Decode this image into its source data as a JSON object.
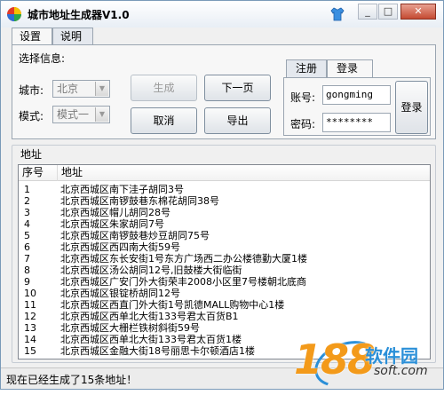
{
  "window": {
    "title": "城市地址生成器V1.0"
  },
  "titlebar_buttons": {
    "minimize": "_",
    "maximize": "□",
    "close": "✕"
  },
  "top_tabs": [
    "设置",
    "说明"
  ],
  "settings": {
    "heading": "选择信息:",
    "city_label": "城市:",
    "city_value": "北京",
    "mode_label": "模式:",
    "mode_value": "模式一",
    "generate_button": "生成",
    "next_page_button": "下一页",
    "cancel_button": "取消",
    "export_button": "导出"
  },
  "account": {
    "tabs": [
      "注册",
      "登录"
    ],
    "username_label": "账号:",
    "username_value": "gongming",
    "password_label": "密码:",
    "password_value": "********",
    "login_button": "登录"
  },
  "address_group": {
    "title": "地址",
    "columns": [
      "序号",
      "地址"
    ],
    "rows": [
      {
        "no": "1",
        "addr": "北京西城区南下洼子胡同3号"
      },
      {
        "no": "2",
        "addr": "北京西城区南锣鼓巷东棉花胡同38号"
      },
      {
        "no": "3",
        "addr": "北京西城区帽儿胡同28号"
      },
      {
        "no": "4",
        "addr": "北京西城区朱家胡同7号"
      },
      {
        "no": "5",
        "addr": "北京西城区南锣鼓巷炒豆胡同75号"
      },
      {
        "no": "6",
        "addr": "北京西城区西四南大街59号"
      },
      {
        "no": "7",
        "addr": "北京西城区东长安街1号东方广场西二办公楼德勤大厦1楼"
      },
      {
        "no": "8",
        "addr": "北京西城区汤公胡同12号,旧鼓楼大街临街"
      },
      {
        "no": "9",
        "addr": "北京西城区广安门外大街荣丰2008小区里7号楼朝北底商"
      },
      {
        "no": "10",
        "addr": "北京西城区银锭桥胡同12号"
      },
      {
        "no": "11",
        "addr": "北京西城区西直门外大街1号凯德MALL购物中心1楼"
      },
      {
        "no": "12",
        "addr": "北京西城区西单北大街133号君太百货B1"
      },
      {
        "no": "13",
        "addr": "北京西城区大栅栏铁树斜街59号"
      },
      {
        "no": "14",
        "addr": "北京西城区西单北大街133号君太百货1楼"
      },
      {
        "no": "15",
        "addr": "北京西城区金融大街18号丽思卡尔顿酒店1楼"
      }
    ]
  },
  "status": {
    "text": "现在已经生成了15条地址！"
  },
  "watermark": {
    "number": "188",
    "name": "软件园",
    "domain": "soft.com"
  },
  "colors": {
    "window_bg": "#f0f0f0",
    "watermark_orange": "#f39a1a",
    "watermark_blue": "#2a8fd8"
  }
}
